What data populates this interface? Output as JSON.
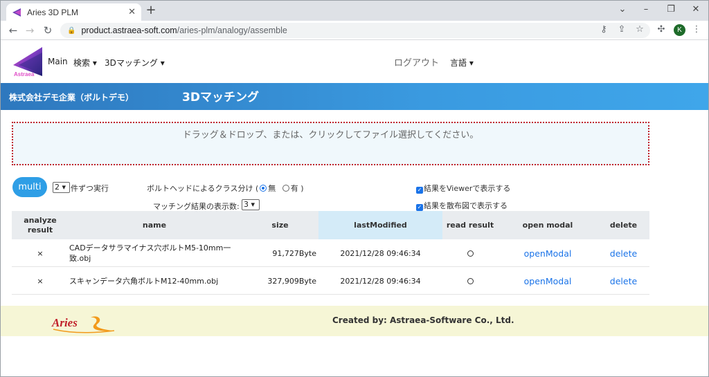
{
  "browser": {
    "tab_title": "Aries 3D PLM",
    "url_host": "product.astraea-soft.com",
    "url_path": "/aries-plm/analogy/assemble",
    "profile_initial": "K"
  },
  "nav": {
    "main": "Main",
    "search": "検索",
    "matching": "3Dマッチング",
    "logout": "ログアウト",
    "language": "言語"
  },
  "banner": {
    "company": "株式会社デモ企業（ボルトデモ）",
    "title": "3Dマッチング"
  },
  "dropzone": {
    "text": "ドラッグ＆ドロップ、または、クリックしてファイル選択してください。"
  },
  "controls": {
    "multi_label": "multi",
    "per_run_value": "2",
    "per_run_suffix": "件ずつ実行",
    "class_split_label": "ボルトヘッドによるクラス分け (",
    "option_none": "無",
    "option_yes": "有 )",
    "display_count_label": "マッチング結果の表示数:",
    "display_count_value": "3",
    "viewer_checkbox": "結果をViewerで表示する",
    "scatter_checkbox": "結果を散布図で表示する"
  },
  "table": {
    "headers": {
      "analyze": "analyze result",
      "name": "name",
      "size": "size",
      "last_modified": "lastModified",
      "read_result": "read result",
      "open_modal": "open modal",
      "delete": "delete"
    },
    "rows": [
      {
        "analyze": "×",
        "name": "CADデータサラマイナス穴ボルトM5-10mm一致.obj",
        "size": "91,727Byte",
        "last_modified": "2021/12/28 09:46:34",
        "open_modal": "openModal",
        "delete": "delete"
      },
      {
        "analyze": "×",
        "name": "スキャンデータ六角ボルトM12-40mm.obj",
        "size": "327,909Byte",
        "last_modified": "2021/12/28 09:46:34",
        "open_modal": "openModal",
        "delete": "delete"
      }
    ]
  },
  "footer": {
    "logo_text": "Aries",
    "credit": "Created by: Astraea-Software Co., Ltd."
  }
}
